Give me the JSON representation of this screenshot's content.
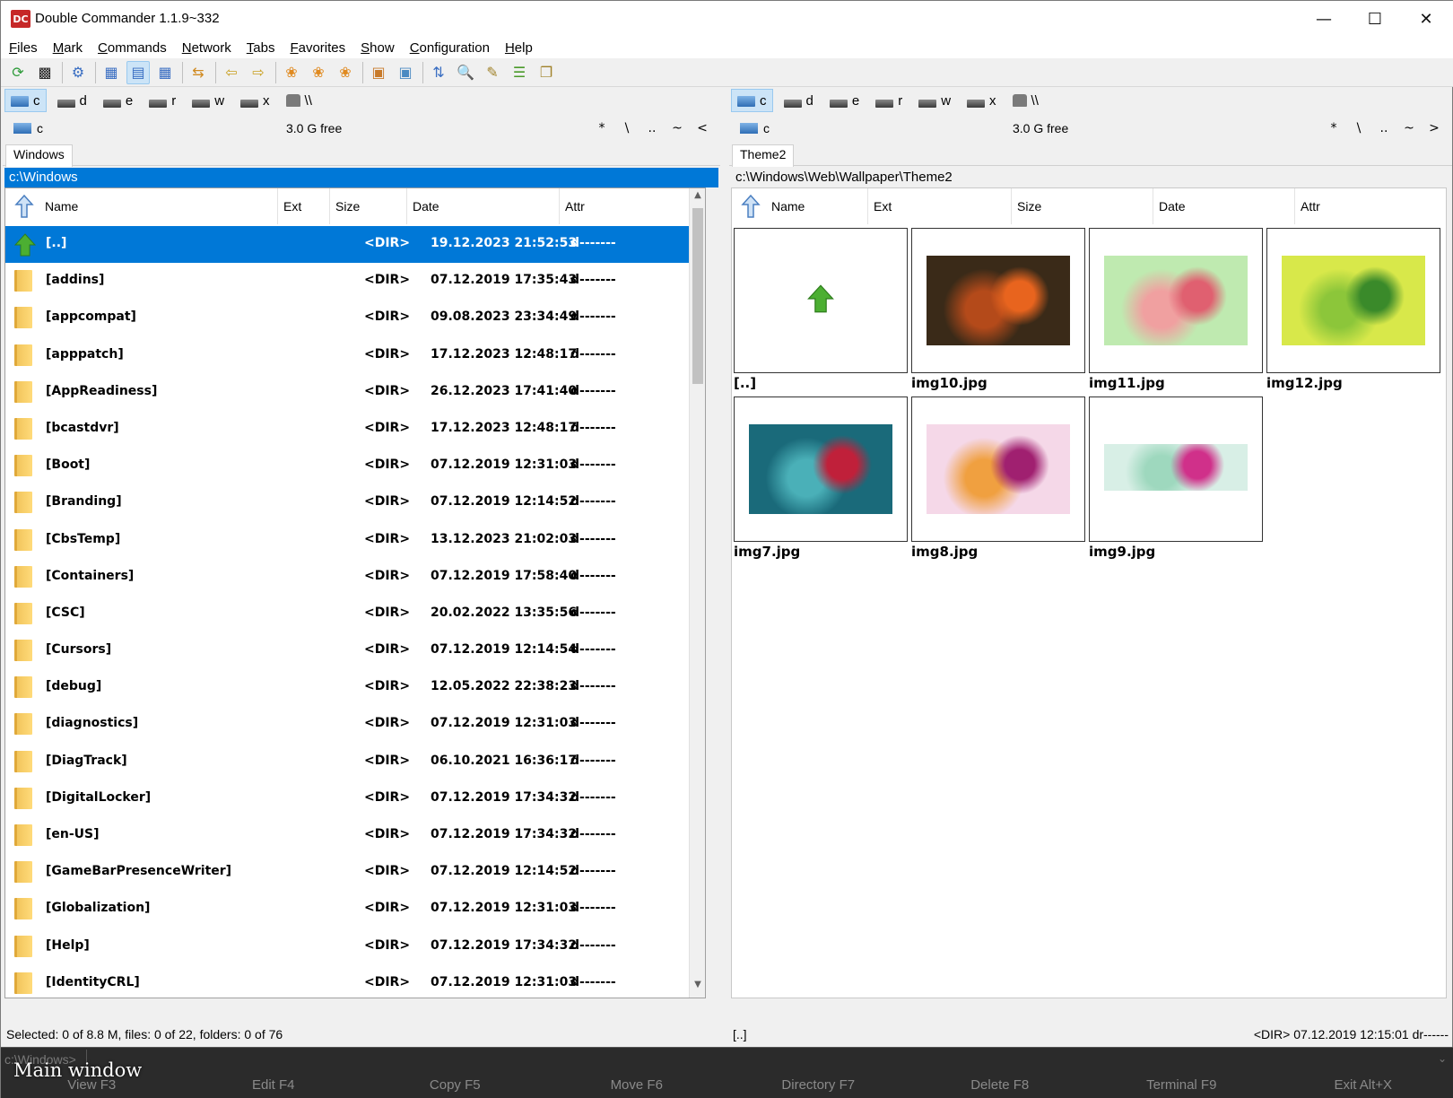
{
  "window": {
    "title": "Double Commander 1.1.9~332",
    "app_icon": "DC"
  },
  "menu": [
    "Files",
    "Mark",
    "Commands",
    "Network",
    "Tabs",
    "Favorites",
    "Show",
    "Configuration",
    "Help"
  ],
  "toolbar": {
    "icons": [
      "refresh-icon",
      "terminal-icon",
      "options-icon",
      "brief-view-icon",
      "full-view-icon",
      "thumbnail-view-icon",
      "compare-dirs-icon",
      "copy-left-icon",
      "copy-right-icon",
      "pack-icon",
      "unpack-icon",
      "test-archive-icon",
      "archive-pack-icon",
      "archive-extract-icon",
      "sync-dirs-icon",
      "search-icon",
      "multi-rename-icon",
      "directory-hotlist-icon",
      "copy-names-icon"
    ]
  },
  "left": {
    "drives": [
      {
        "label": "c",
        "active": true
      },
      {
        "label": "d"
      },
      {
        "label": "e"
      },
      {
        "label": "r"
      },
      {
        "label": "w"
      },
      {
        "label": "x"
      },
      {
        "label": "\\\\"
      }
    ],
    "drive_name": "c",
    "free_space": "3.0 G free",
    "nav": [
      "*",
      "\\",
      "..",
      "~",
      "<"
    ],
    "tab": "Windows",
    "path": "c:\\Windows",
    "columns": [
      "Name",
      "Ext",
      "Size",
      "Date",
      "Attr"
    ],
    "rows": [
      {
        "name": "[..]",
        "size": "<DIR>",
        "date": "19.12.2023 21:52:53",
        "attr": "d-------",
        "selected": true,
        "updir": true
      },
      {
        "name": "[addins]",
        "size": "<DIR>",
        "date": "07.12.2019 17:35:43",
        "attr": "d-------"
      },
      {
        "name": "[appcompat]",
        "size": "<DIR>",
        "date": "09.08.2023 23:34:49",
        "attr": "d-------"
      },
      {
        "name": "[apppatch]",
        "size": "<DIR>",
        "date": "17.12.2023 12:48:17",
        "attr": "d-------"
      },
      {
        "name": "[AppReadiness]",
        "size": "<DIR>",
        "date": "26.12.2023 17:41:40",
        "attr": "d-------"
      },
      {
        "name": "[bcastdvr]",
        "size": "<DIR>",
        "date": "17.12.2023 12:48:17",
        "attr": "d-------"
      },
      {
        "name": "[Boot]",
        "size": "<DIR>",
        "date": "07.12.2019 12:31:03",
        "attr": "d-------"
      },
      {
        "name": "[Branding]",
        "size": "<DIR>",
        "date": "07.12.2019 12:14:52",
        "attr": "d-------"
      },
      {
        "name": "[CbsTemp]",
        "size": "<DIR>",
        "date": "13.12.2023 21:02:03",
        "attr": "d-------"
      },
      {
        "name": "[Containers]",
        "size": "<DIR>",
        "date": "07.12.2019 17:58:40",
        "attr": "d-------"
      },
      {
        "name": "[CSC]",
        "size": "<DIR>",
        "date": "20.02.2022 13:35:56",
        "attr": "d-------"
      },
      {
        "name": "[Cursors]",
        "size": "<DIR>",
        "date": "07.12.2019 12:14:54",
        "attr": "d-------"
      },
      {
        "name": "[debug]",
        "size": "<DIR>",
        "date": "12.05.2022 22:38:23",
        "attr": "d-------"
      },
      {
        "name": "[diagnostics]",
        "size": "<DIR>",
        "date": "07.12.2019 12:31:03",
        "attr": "d-------"
      },
      {
        "name": "[DiagTrack]",
        "size": "<DIR>",
        "date": "06.10.2021 16:36:17",
        "attr": "d-------"
      },
      {
        "name": "[DigitalLocker]",
        "size": "<DIR>",
        "date": "07.12.2019 17:34:32",
        "attr": "d-------"
      },
      {
        "name": "[en-US]",
        "size": "<DIR>",
        "date": "07.12.2019 17:34:32",
        "attr": "d-------"
      },
      {
        "name": "[GameBarPresenceWriter]",
        "size": "<DIR>",
        "date": "07.12.2019 12:14:52",
        "attr": "d-------"
      },
      {
        "name": "[Globalization]",
        "size": "<DIR>",
        "date": "07.12.2019 12:31:03",
        "attr": "d-------"
      },
      {
        "name": "[Help]",
        "size": "<DIR>",
        "date": "07.12.2019 17:34:32",
        "attr": "d-------"
      },
      {
        "name": "[IdentityCRL]",
        "size": "<DIR>",
        "date": "07.12.2019 12:31:03",
        "attr": "d-------"
      }
    ],
    "status": "Selected: 0 of 8.8 M, files: 0 of 22, folders: 0 of 76"
  },
  "right": {
    "drives": [
      {
        "label": "c",
        "active": true
      },
      {
        "label": "d"
      },
      {
        "label": "e"
      },
      {
        "label": "r"
      },
      {
        "label": "w"
      },
      {
        "label": "x"
      },
      {
        "label": "\\\\"
      }
    ],
    "drive_name": "c",
    "free_space": "3.0 G free",
    "nav": [
      "*",
      "\\",
      "..",
      "~",
      ">"
    ],
    "tab": "Theme2",
    "path": "c:\\Windows\\Web\\Wallpaper\\Theme2",
    "columns": [
      "Name",
      "Ext",
      "Size",
      "Date",
      "Attr"
    ],
    "thumbnails": [
      {
        "label": "[..]",
        "kind": "updir"
      },
      {
        "label": "img10.jpg",
        "kind": "image",
        "palette": [
          "#3a2a18",
          "#b44a1a",
          "#e8641e"
        ]
      },
      {
        "label": "img11.jpg",
        "kind": "image",
        "palette": [
          "#bfeab0",
          "#f0a0a0",
          "#e06070"
        ]
      },
      {
        "label": "img12.jpg",
        "kind": "image",
        "palette": [
          "#d8e84a",
          "#8cc63a",
          "#3a8a2a"
        ]
      },
      {
        "label": "img7.jpg",
        "kind": "image",
        "palette": [
          "#1a6a7a",
          "#4ab0b8",
          "#c0203a"
        ]
      },
      {
        "label": "img8.jpg",
        "kind": "image",
        "palette": [
          "#f5d8e8",
          "#f0a040",
          "#a02070"
        ]
      },
      {
        "label": "img9.jpg",
        "kind": "image",
        "palette": [
          "#d8efe6",
          "#9ed8be",
          "#d0308a"
        ]
      }
    ],
    "status_left": "[..]",
    "status_right": "<DIR>  07.12.2019 12:15:01  dr------"
  },
  "cmdline": {
    "prompt": "c:\\Windows>"
  },
  "function_keys": [
    "View F3",
    "Edit F4",
    "Copy F5",
    "Move F6",
    "Directory F7",
    "Delete F8",
    "Terminal F9",
    "Exit Alt+X"
  ],
  "caption": "Main window",
  "colors": {
    "selection": "#0078d7",
    "folder": "#f2c55c",
    "updir_arrow": "#4caf32"
  }
}
